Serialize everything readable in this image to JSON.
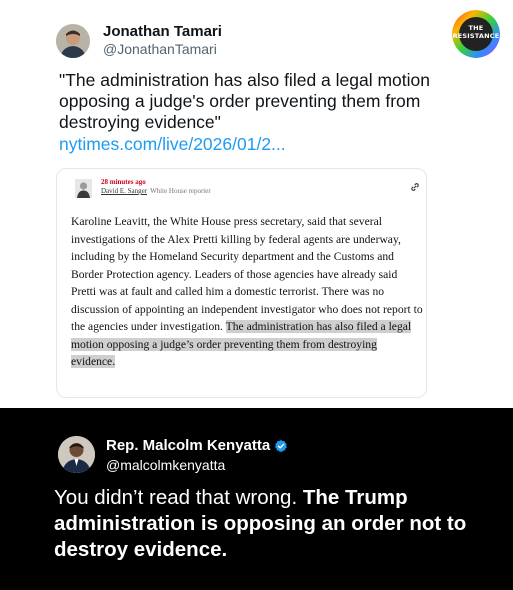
{
  "tweet1": {
    "author_name": "Jonathan Tamari",
    "author_handle": "@JonathanTamari",
    "text": "\"The administration has also filed a legal motion opposing a judge's order preventing them from destroying evidence\"",
    "link": "nytimes.com/live/2026/01/2..."
  },
  "watermark": {
    "line1": "THE",
    "line2": "RESISTANCE"
  },
  "article": {
    "time": "28 minutes ago",
    "reporter": "David E. Sanger",
    "role": "White House reporter",
    "body_plain": "Karoline Leavitt, the White House press secretary, said that several investigations of the Alex Pretti killing by federal agents are underway, including by the Homeland Security department and the Customs and Border Protection agency. Leaders of those agencies have already said Pretti was at fault and called him a domestic terrorist. There was no discussion of appointing an independent investigator who does not report to the agencies under investigation.",
    "body_highlight": "The administration has also filed a legal motion opposing a judge’s order preventing them from destroying evidence."
  },
  "tweet2": {
    "author_name": "Rep. Malcolm Kenyatta",
    "author_handle": "@malcolmkenyatta",
    "text_plain": "You didn’t read that wrong.",
    "text_bold": "The Trump administration is opposing an order not to destroy evidence."
  },
  "colors": {
    "link": "#1d9bf0",
    "verified": "#1d9bf0",
    "time_red": "#d0021b",
    "highlight": "#cfcfcf"
  }
}
